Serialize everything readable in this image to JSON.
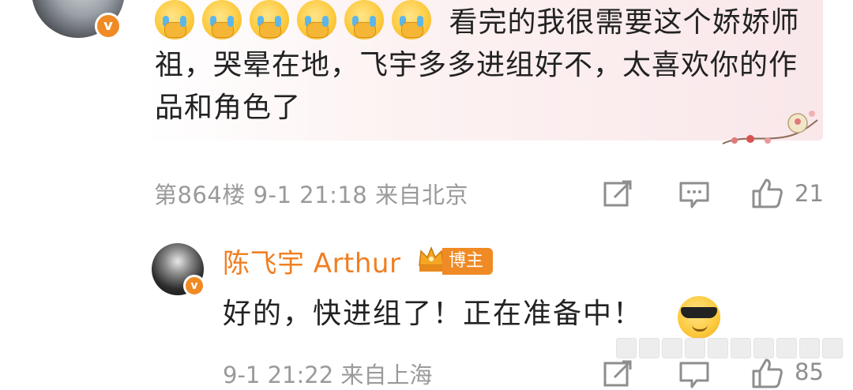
{
  "comment": {
    "emoji_count": 6,
    "emoji_name": "cry-cover-mouth-emoji",
    "text": "看完的我很需要这个娇娇师祖，哭晕在地，飞宇多多进组好不，太喜欢你的作品和角色了",
    "floor": "第864楼",
    "time": "9-1 21:18",
    "location": "来自北京",
    "likes": "21"
  },
  "reply": {
    "author": "陈飞宇 Arthur",
    "badge": "博主",
    "text": "好的，快进组了！正在准备中！",
    "emoji_name": "sunglasses-emoji",
    "time": "9-1 21:22",
    "location": "来自上海",
    "likes": "85"
  },
  "verified_mark": "v",
  "colors": {
    "accent": "#f08a24",
    "name": "#f07f23",
    "meta": "#9a9a9a"
  }
}
